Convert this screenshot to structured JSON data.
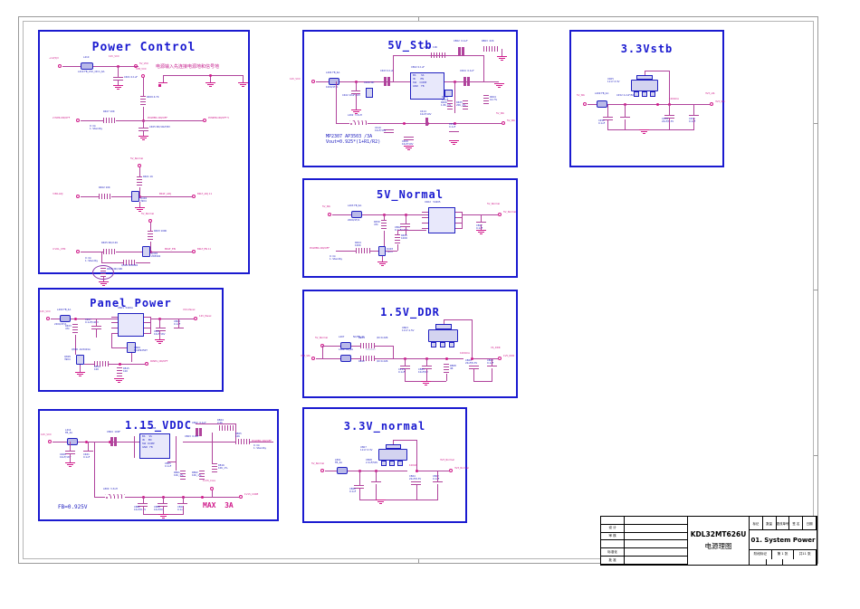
{
  "document": {
    "type": "electronic-schematic",
    "sheet_title_cn": "电源理图",
    "model": "KDL32MT626U",
    "sheet_name": "01. System Power",
    "page_label": "第 1 张",
    "page_total_label": "共11 张"
  },
  "blocks": [
    {
      "id": "power-control",
      "title": "Power Control",
      "notes": [
        {
          "text": "电源输入先连接电源地和信号地",
          "kind": "cn"
        }
      ],
      "nets": [
        "+12(5)V",
        "12V_VCC",
        "STB_VCC",
        "5V_VM",
        "5V_Normal",
        "PWR-ON/OFF",
        "POWER-ON/OFF",
        "BKLT_ADJ",
        "BKLT_EN",
        "VOL_CTN"
      ],
      "parts": [
        "L410 FB_VCC_Ohm_6A",
        "C401 0.1uF",
        "R409 4.7K",
        "R407 10K",
        "C405 NC/10uF/6V",
        "R401 1K",
        "R402 10K",
        "Q404 2N3904",
        "R404 NC/4.7K",
        "R403 100K",
        "R405 NC/2.2K",
        "Q404 2N3904",
        "R406 NC/10K"
      ],
      "pin_labels": [
        "2  PWR-ON/OFF",
        "3  BR-ADJ",
        "4  VOL_CTN"
      ],
      "state_note": "0: On\n1: Standby"
    },
    {
      "id": "5v-stb",
      "title": "5V_Stb",
      "notes": [
        {
          "text": "MP2307 AP3503 /3A\nVout=0.925*(1+R1/R2)",
          "kind": "blue"
        }
      ],
      "nets": [
        "12V_VCC",
        "5V_Stb"
      ],
      "parts": [
        "L404 FB_6A",
        "C403 0.1uF",
        "C402 10uF/16V",
        "C406 NC",
        "R402 10K",
        "U401 FR9888",
        "C802 0.1uF",
        "R403 22K",
        "C404 0.1uF",
        "C408 0.1uF",
        "R404 10.7K",
        "R406 1.8K_1%",
        "R405 20K_1%",
        "L402 3.3uH",
        "C414 10uF/10V",
        "C410 10uF/10V",
        "C409 10uF/10V",
        "C411 0.1uF"
      ]
    },
    {
      "id": "3-3vstb",
      "title": "3.3Vstb",
      "notes": [],
      "nets": [
        "5V_Stb",
        "3V3_stb",
        "3V3_Stb"
      ],
      "parts": [
        "L409 FB_4A",
        "C452 2.2uF/50V",
        "C453 0.1uF",
        "U405 1117-3.3V",
        "C454 22uF/6.3V",
        "C455 0.1uF"
      ]
    },
    {
      "id": "5v-normal",
      "title": "5V_Normal",
      "notes": [],
      "nets": [
        "5V_Stb",
        "5V_Normal",
        "POWER-ON/OFF"
      ],
      "parts": [
        "L403 FB_6A",
        "R450 47k",
        "C802 0.1uF/100V",
        "R405 100R",
        "Q403 3904",
        "R404 100K",
        "U402 54205",
        "C807 0.1uF"
      ],
      "state_note": "0: On\n1: Standby"
    },
    {
      "id": "panel-power",
      "title": "Panel Power",
      "notes": [],
      "nets": [
        "12V_VCC",
        "VCC-Panel",
        "12V_Panel",
        "PANEL_ON/OFF"
      ],
      "parts": [
        "L400 FB_4A",
        "R403 47k",
        "C407 0.1uF/100V",
        "U801 5420A",
        "C408 10uF/16V",
        "C809 0.1uF",
        "Q806 AO3401A",
        "U806 SC4P9250T",
        "Q805 2N3904",
        "R814 100",
        "R815 100"
      ]
    },
    {
      "id": "1-5v-ddr",
      "title": "1.5V_DDR",
      "notes": [],
      "nets": [
        "5V_Normal",
        "3V3_Stb",
        "1V5_DDR",
        "VS_DDR"
      ],
      "parts": [
        "L407 NC/FB_4A",
        "L408 FB_4A",
        "R404 /R=0.22R",
        "R402 /R=0.22R",
        "C413 0.1uF",
        "C805 10uF/6V",
        "R808 4R",
        "U803 1117-1.5V",
        "C809 22uF/6.3V",
        "C803 0.1uF"
      ]
    },
    {
      "id": "1-15-vddc",
      "title": "1.15_VDDC",
      "notes": [
        {
          "text": "FB=0.925V",
          "kind": "blue"
        },
        {
          "text": "MAX  3A",
          "kind": "red"
        }
      ],
      "nets": [
        "12V_VCC",
        "POWER-ON/OFF",
        "1V15_Core",
        "1V15_CORE"
      ],
      "parts": [
        "L414 FB_4A",
        "C460 10uF/16V",
        "C461 0.1uF",
        "C864 0.1uF",
        "R801 FR9888",
        "C862 0.1uF",
        "R864 2.2K",
        "C863 0.1uF",
        "R805 10K",
        "C865 0.1uF",
        "R861 10K_1%",
        "R862 10K_1%",
        "R816 10K_1%",
        "L800 3.3uH",
        "C862 10uF/6.3V",
        "C808 10uF/6V",
        "C800 0.1uF"
      ],
      "state_note": "0: On\n1: Standby"
    },
    {
      "id": "3-3v-normal",
      "title": "3.3V_normal",
      "notes": [],
      "nets": [
        "5V_Normal",
        "3V3_Normal",
        "3V3_Normal"
      ],
      "parts": [
        "L801 FB_4A",
        "C808 2.2uF/50V",
        "C860 0.1uF",
        "U807 1117-3.3V",
        "C864 22uF/6.3V",
        "C862 0.1uF"
      ]
    }
  ],
  "title_block": {
    "left_rows": [
      {
        "label": "",
        "value": ""
      },
      {
        "label": "",
        "value": ""
      },
      {
        "label": "设 计",
        "value": ""
      },
      {
        "label": "审 核",
        "value": ""
      },
      {
        "label": "",
        "value": ""
      },
      {
        "label": "标准化",
        "value": ""
      },
      {
        "label": "批 准",
        "value": ""
      }
    ],
    "revision_headers": [
      "标记",
      "数量",
      "更改单号",
      "签 名",
      "日期"
    ],
    "stage_label": "阶段标记",
    "scale_cells": [
      "",
      ""
    ]
  }
}
